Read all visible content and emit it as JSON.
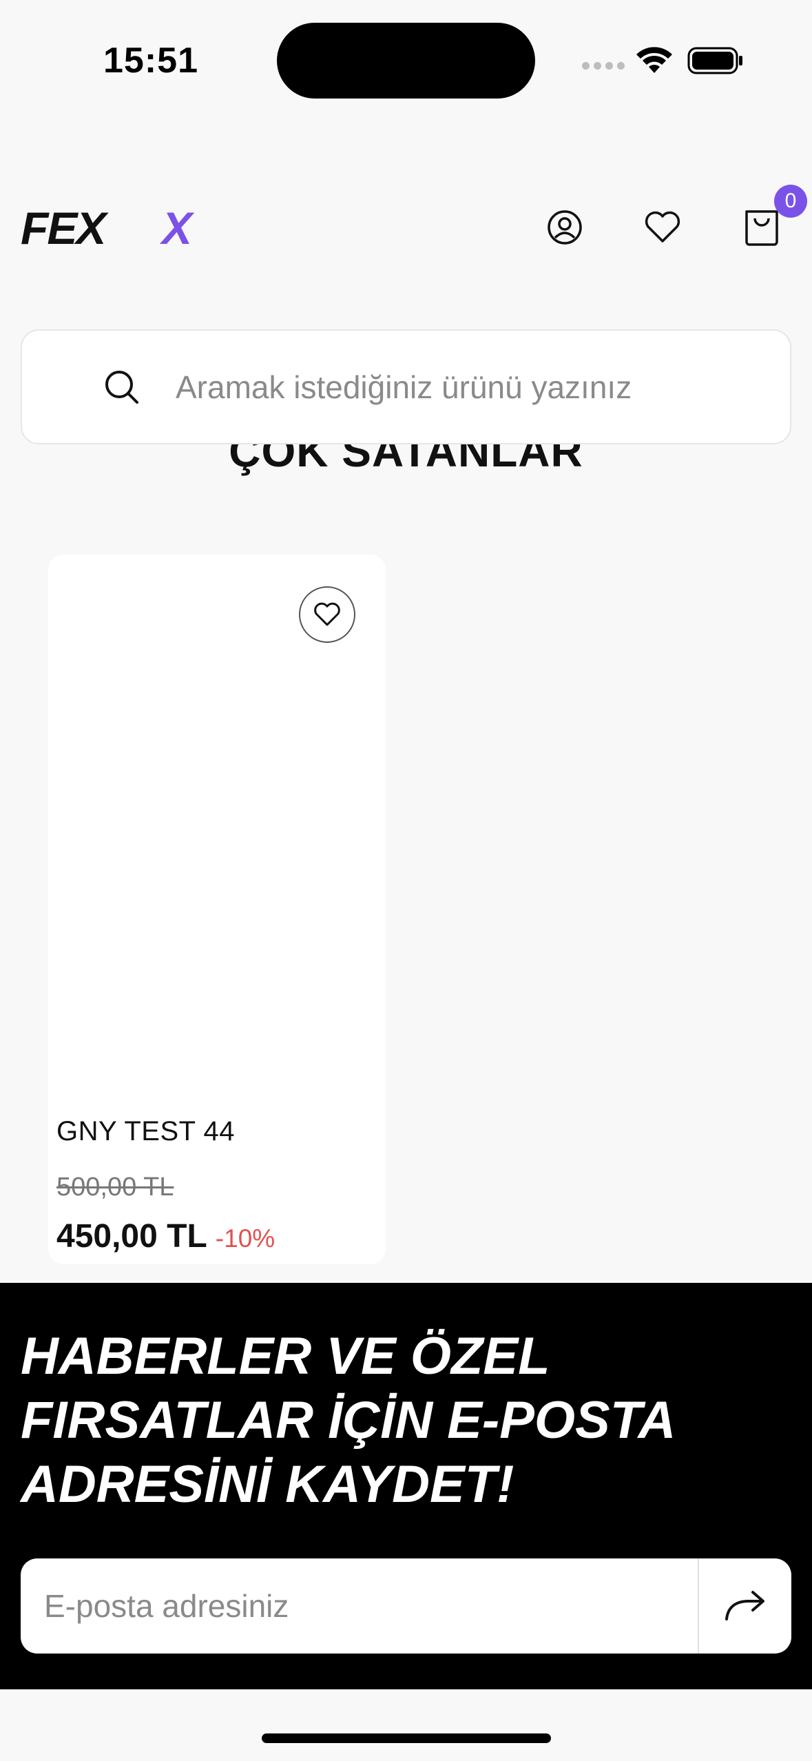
{
  "status_bar": {
    "time": "15:51"
  },
  "header": {
    "logo_text": "FEXX",
    "cart_count": "0",
    "icons": [
      "user-icon",
      "heart-icon",
      "cart-icon"
    ],
    "accent_color": "#7b52e8"
  },
  "search": {
    "placeholder": "Aramak istediğiniz ürünü yazınız"
  },
  "section": {
    "title": "ÇOK SATANLAR"
  },
  "products": [
    {
      "name": "GNY TEST 44",
      "old_price": "500,00 TL",
      "price": "450,00 TL",
      "discount": "-10%"
    }
  ],
  "newsletter": {
    "title_lines": [
      "HABERLER VE ÖZEL",
      "FIRSATLAR İÇİN E-POSTA",
      "ADRESİNİ KAYDET!"
    ],
    "email_placeholder": "E-posta adresiniz"
  }
}
